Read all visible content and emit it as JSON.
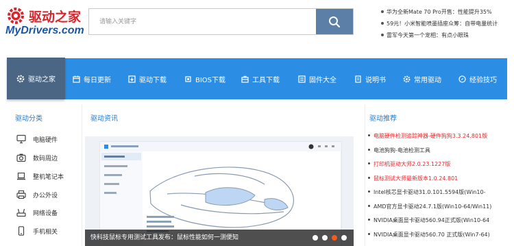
{
  "logo": {
    "cn": "驱动之家",
    "en": "MyDrivers.com"
  },
  "search": {
    "placeholder": "请输入关键字"
  },
  "news": [
    "华为全新Mate 70 Pro开售：性能提升35%",
    "59元！小米智能喷墨插座众筹：自带电量统计",
    "雷军今天第一个宠相：有点小眼珠"
  ],
  "nav": {
    "home": "驱动之家",
    "items": [
      "每日更新",
      "驱动下载",
      "BIOS下载",
      "工具下载",
      "固件大全",
      "说明书",
      "常用驱动",
      "经验技巧"
    ]
  },
  "sidebar": {
    "title": "驱动分类",
    "items": [
      "电脑硬件",
      "数码周边",
      "整机笔记本",
      "办公外设",
      "网络设备",
      "手机相关"
    ]
  },
  "feature": {
    "title": "驱动资讯",
    "caption": "快科技鼠标专用测试工具发布：鼠标性能如何一测便知",
    "slide_count": 4,
    "active_slide": 3
  },
  "recommend": {
    "title": "驱动推荐",
    "items": [
      {
        "text": "电脑硬件检测追踪神器-硬件狗狗3.3.24.801版",
        "color": "#e8262a"
      },
      {
        "text": "电池狗狗-电池检测工具",
        "color": "#333333"
      },
      {
        "text": "打印机驱动大师2.0.23.1227版",
        "color": "#e8262a"
      },
      {
        "text": "鼠标测试大师最新版本1.0.24.801",
        "color": "#e8262a"
      },
      {
        "text": "Intel核芯显卡驱动31.0.101.5594版(Win10-",
        "color": "#333333"
      },
      {
        "text": "AMD官方显卡驱动24.7.1版(Win10-64/Win11)",
        "color": "#333333"
      },
      {
        "text": "NVIDIA桌面显卡驱动560.94正式版(Win10-64",
        "color": "#333333"
      },
      {
        "text": "NVIDIA桌面显卡驱动560.70 正式版(Win7-64)",
        "color": "#333333"
      }
    ]
  },
  "colors": {
    "nav_bg": "#2b8ee4",
    "nav_home_bg": "#4a6684",
    "search_btn": "#5c7fa8",
    "accent_red": "#e8262a",
    "title_blue": "#2b79c4"
  }
}
